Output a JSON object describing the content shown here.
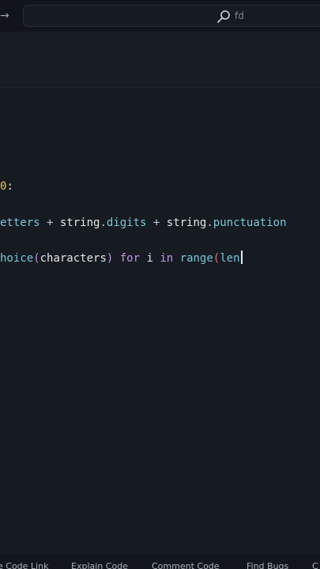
{
  "search": {
    "text": "fd"
  },
  "editor": {
    "lines": [
      {
        "parts": [
          {
            "t": "0",
            "c": "punc"
          },
          {
            "t": ":",
            "c": "text"
          }
        ]
      },
      {
        "parts": [
          {
            "t": "etters",
            "c": "attr"
          },
          {
            "t": " + ",
            "c": "op"
          },
          {
            "t": "string",
            "c": "text"
          },
          {
            "t": ".",
            "c": "op"
          },
          {
            "t": "digits",
            "c": "attr"
          },
          {
            "t": " + ",
            "c": "op"
          },
          {
            "t": "string",
            "c": "text"
          },
          {
            "t": ".",
            "c": "op"
          },
          {
            "t": "punctuation",
            "c": "attr"
          }
        ]
      },
      {
        "parts": [
          {
            "t": "hoice",
            "c": "attr"
          },
          {
            "t": "(",
            "c": "paren"
          },
          {
            "t": "characters",
            "c": "text"
          },
          {
            "t": ")",
            "c": "paren"
          },
          {
            "t": " for ",
            "c": "kw"
          },
          {
            "t": "i",
            "c": "text"
          },
          {
            "t": " in ",
            "c": "kw"
          },
          {
            "t": "range",
            "c": "attr"
          },
          {
            "t": "(",
            "c": "paren2"
          },
          {
            "t": "len",
            "c": "attr"
          }
        ]
      }
    ]
  },
  "statusbar": {
    "items": [
      "e Code Link",
      "Explain Code",
      "Comment Code",
      "Find Bugs",
      "C"
    ]
  }
}
